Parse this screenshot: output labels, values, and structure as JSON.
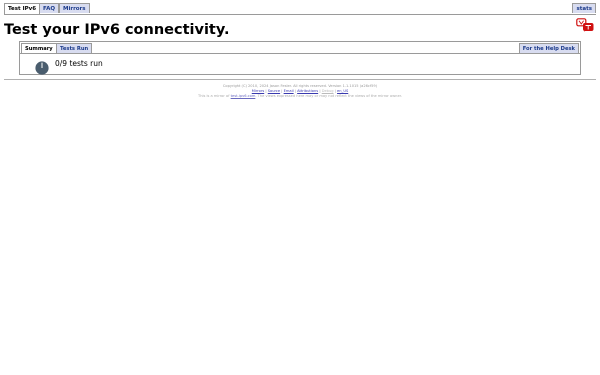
{
  "nav": {
    "tabs": [
      {
        "label": "Test IPv6"
      },
      {
        "label": "FAQ"
      },
      {
        "label": "Mirrors"
      }
    ],
    "stats_label": "stats"
  },
  "page": {
    "title": "Test your IPv6 connectivity."
  },
  "panel": {
    "tabs": [
      {
        "label": "Summary"
      },
      {
        "label": "Tests Run"
      }
    ],
    "help_label": "For the Help Desk",
    "status_text": "0/9 tests run"
  },
  "footer": {
    "copyright": "Copyright (C) 2010, 2024 Jason Fesler. All rights reserved. Version 1.1.1015 (a26cf59)",
    "links": [
      "Mirrors",
      "Source",
      "Email",
      "Attributions",
      "Debug"
    ],
    "locale_label": "en_US",
    "mirror_prefix": "This is a mirror of",
    "mirror_link": "test-ipv6.com",
    "mirror_suffix": ". The views expressed here may or may not reflect the views of the mirror owner."
  },
  "colors": {
    "inactive_tab_bg": "#d8dcf0",
    "inactive_tab_text": "#1b3a8a",
    "gauge_fill": "#4a5d6e",
    "lang_icon": "#d01010"
  },
  "icons": {
    "language": "language-icon",
    "gauge": "gauge-icon"
  }
}
